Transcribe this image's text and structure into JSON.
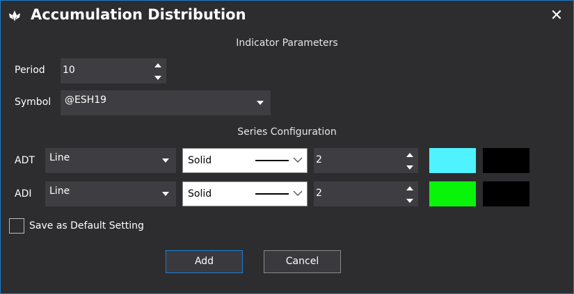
{
  "window": {
    "title": "Accumulation Distribution",
    "close_label": "✕"
  },
  "indicator_parameters": {
    "heading": "Indicator Parameters",
    "period": {
      "label": "Period",
      "value": "10"
    },
    "symbol": {
      "label": "Symbol",
      "value": "@ESH19"
    }
  },
  "series_configuration": {
    "heading": "Series Configuration",
    "rows": [
      {
        "label": "ADT",
        "plot_type": "Line",
        "line_style": "Solid",
        "width": "2",
        "color": "#4ef3ff",
        "secondary_color": "#000000"
      },
      {
        "label": "ADI",
        "plot_type": "Line",
        "line_style": "Solid",
        "width": "2",
        "color": "#08f50a",
        "secondary_color": "#000000"
      }
    ]
  },
  "save_default": {
    "label": "Save as Default Setting",
    "checked": false
  },
  "buttons": {
    "add": "Add",
    "cancel": "Cancel"
  },
  "colors": {
    "background": "#2d2d30",
    "field": "#3e3e42",
    "accent": "#1f7fd4"
  }
}
